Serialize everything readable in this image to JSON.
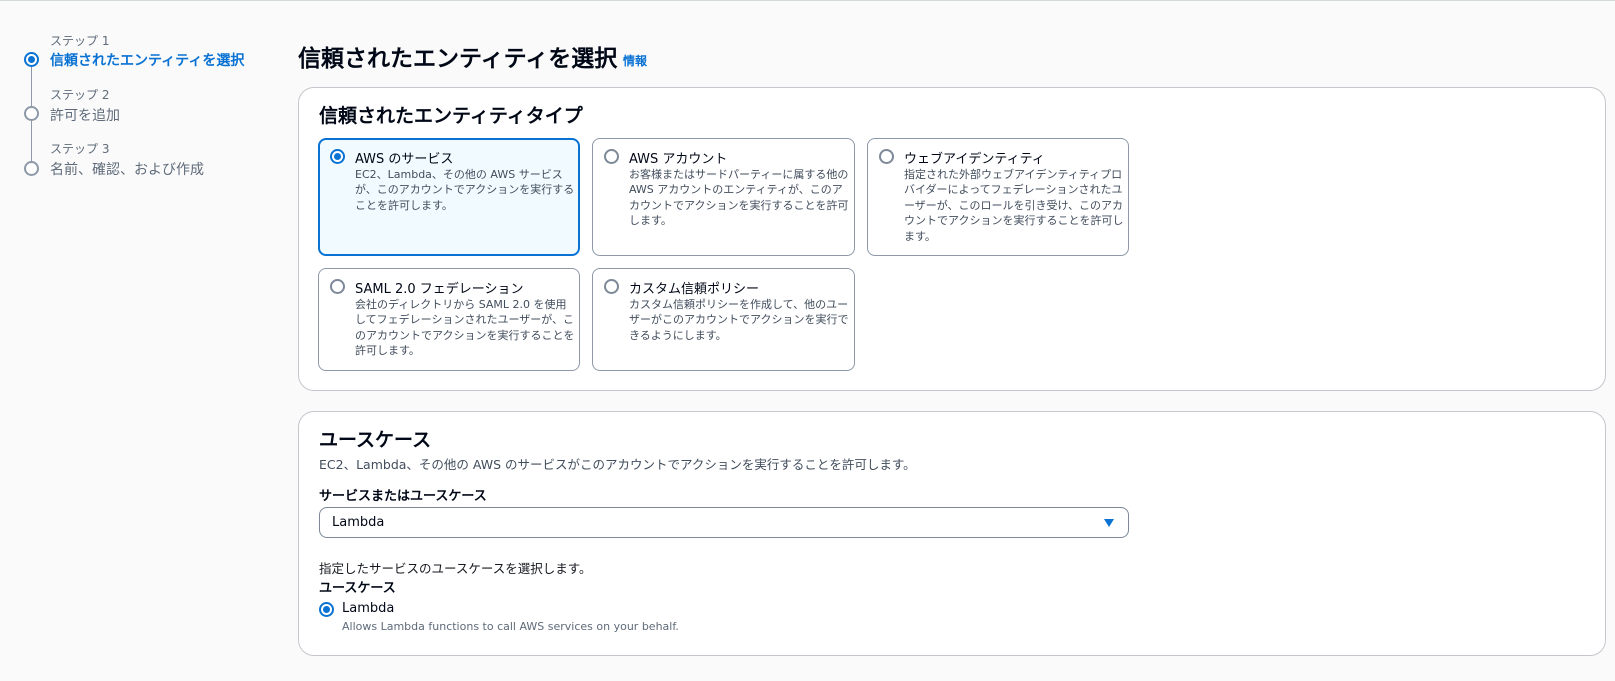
{
  "stepper": {
    "steps": [
      {
        "number": "ステップ 1",
        "title": "信頼されたエンティティを選択",
        "state": "active"
      },
      {
        "number": "ステップ 2",
        "title": "許可を追加",
        "state": "pending"
      },
      {
        "number": "ステップ 3",
        "title": "名前、確認、および作成",
        "state": "pending"
      }
    ]
  },
  "header": {
    "title": "信頼されたエンティティを選択",
    "info_link": "情報"
  },
  "entity_type": {
    "title": "信頼されたエンティティタイプ",
    "selected": "AWS のサービス",
    "options": [
      {
        "title": "AWS のサービス",
        "description": "EC2、Lambda、その他の AWS サービスが、このアカウントでアクションを実行することを許可します。"
      },
      {
        "title": "AWS アカウント",
        "description": "お客様またはサードパーティーに属する他の AWS アカウントのエンティティが、このアカウントでアクションを実行することを許可します。"
      },
      {
        "title": "ウェブアイデンティティ",
        "description": "指定された外部ウェブアイデンティティプロバイダーによってフェデレーションされたユーザーが、このロールを引き受け、このアカウントでアクションを実行することを許可します。"
      },
      {
        "title": "SAML 2.0 フェデレーション",
        "description": "会社のディレクトリから SAML 2.0 を使用してフェデレーションされたユーザーが、このアカウントでアクションを実行することを許可します。"
      },
      {
        "title": "カスタム信頼ポリシー",
        "description": "カスタム信頼ポリシーを作成して、他のユーザーがこのアカウントでアクションを実行できるようにします。"
      }
    ]
  },
  "use_case": {
    "title": "ユースケース",
    "description": "EC2、Lambda、その他の AWS のサービスがこのアカウントでアクションを実行することを許可します。",
    "service_label": "サービスまたはユースケース",
    "service_value": "Lambda",
    "help_text": "指定したサービスのユースケースを選択します。",
    "use_case_label": "ユースケース",
    "option": {
      "label": "Lambda",
      "description": "Allows Lambda functions to call AWS services on your behalf.",
      "selected": true
    }
  },
  "colors": {
    "accent": "#0972d3",
    "selected_tile_bg": "#f1faff",
    "border": "#8d99a8"
  }
}
